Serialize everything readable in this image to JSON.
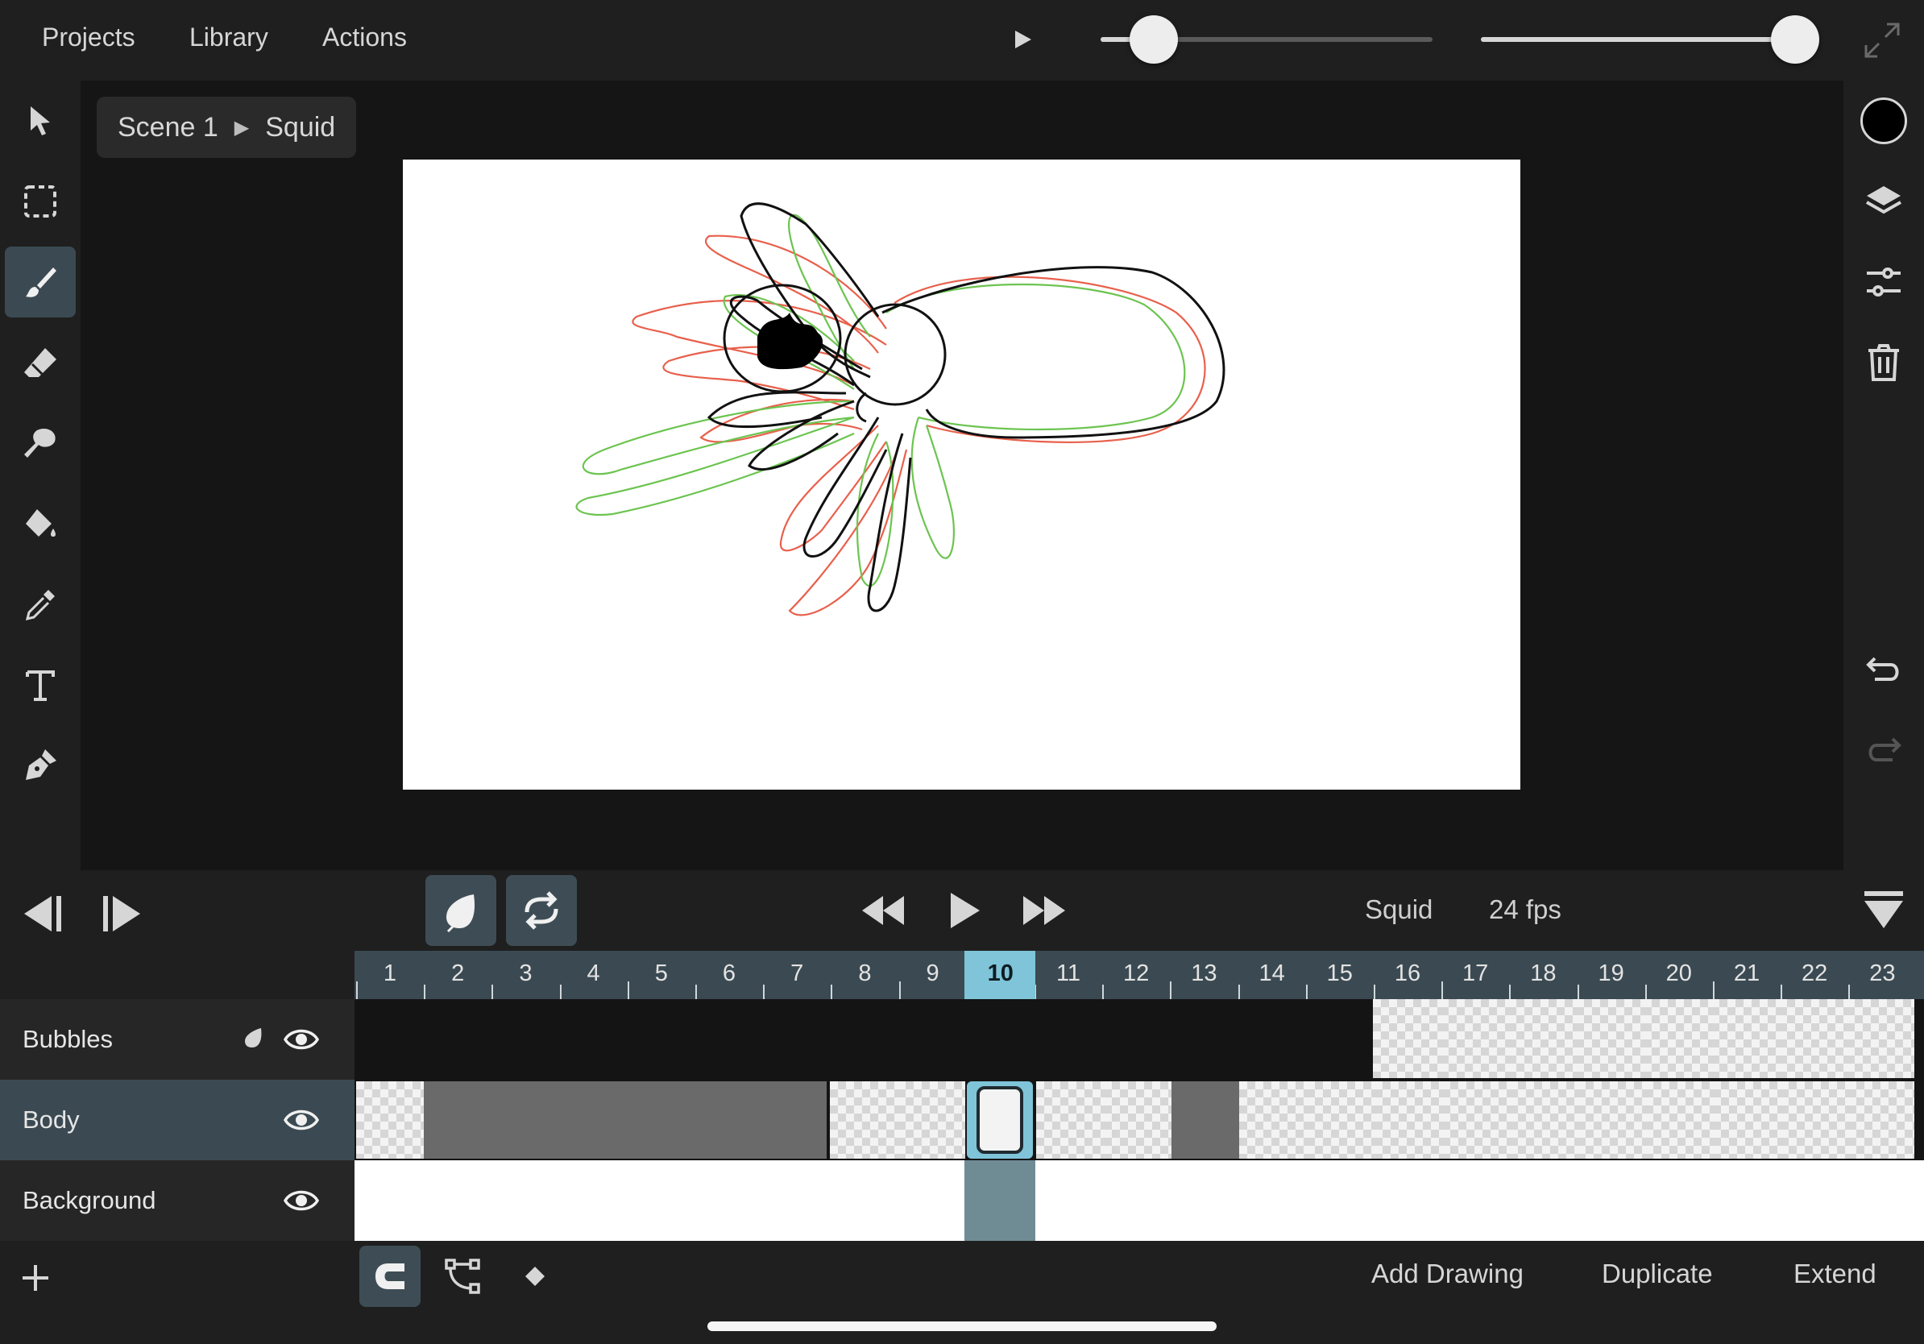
{
  "menu": {
    "projects": "Projects",
    "library": "Library",
    "actions": "Actions"
  },
  "sliders": {
    "brush_size": 0.16,
    "opacity": 1.0
  },
  "breadcrumb": {
    "scene": "Scene 1",
    "separator": "▶",
    "layer": "Squid"
  },
  "tools": [
    "select-arrow",
    "marquee-select",
    "brush",
    "eraser",
    "smudge",
    "fill-bucket",
    "eyedropper",
    "text",
    "pen"
  ],
  "active_tool": "brush",
  "right_tools": [
    "color-swatch",
    "layers",
    "adjustments",
    "trash",
    "undo",
    "redo"
  ],
  "current_color": "#000000",
  "transport": {
    "clip_name": "Squid",
    "fps_label": "24 fps"
  },
  "timeline": {
    "frames": [
      "1",
      "2",
      "3",
      "4",
      "5",
      "6",
      "7",
      "8",
      "9",
      "10",
      "11",
      "12",
      "13",
      "14",
      "15",
      "16",
      "17",
      "18",
      "19",
      "20",
      "21",
      "22",
      "23"
    ],
    "current_frame": "10",
    "layers": [
      {
        "name": "Bubbles",
        "visible": true
      },
      {
        "name": "Body",
        "visible": true,
        "selected": true
      },
      {
        "name": "Background",
        "visible": true
      }
    ]
  },
  "bottom_actions": {
    "add_drawing": "Add Drawing",
    "duplicate": "Duplicate",
    "extend": "Extend"
  },
  "colors": {
    "accent": "#7fc4d8",
    "selected_row": "#3b4a52",
    "onion_prev": "#e8604c",
    "onion_next": "#6cc450"
  }
}
